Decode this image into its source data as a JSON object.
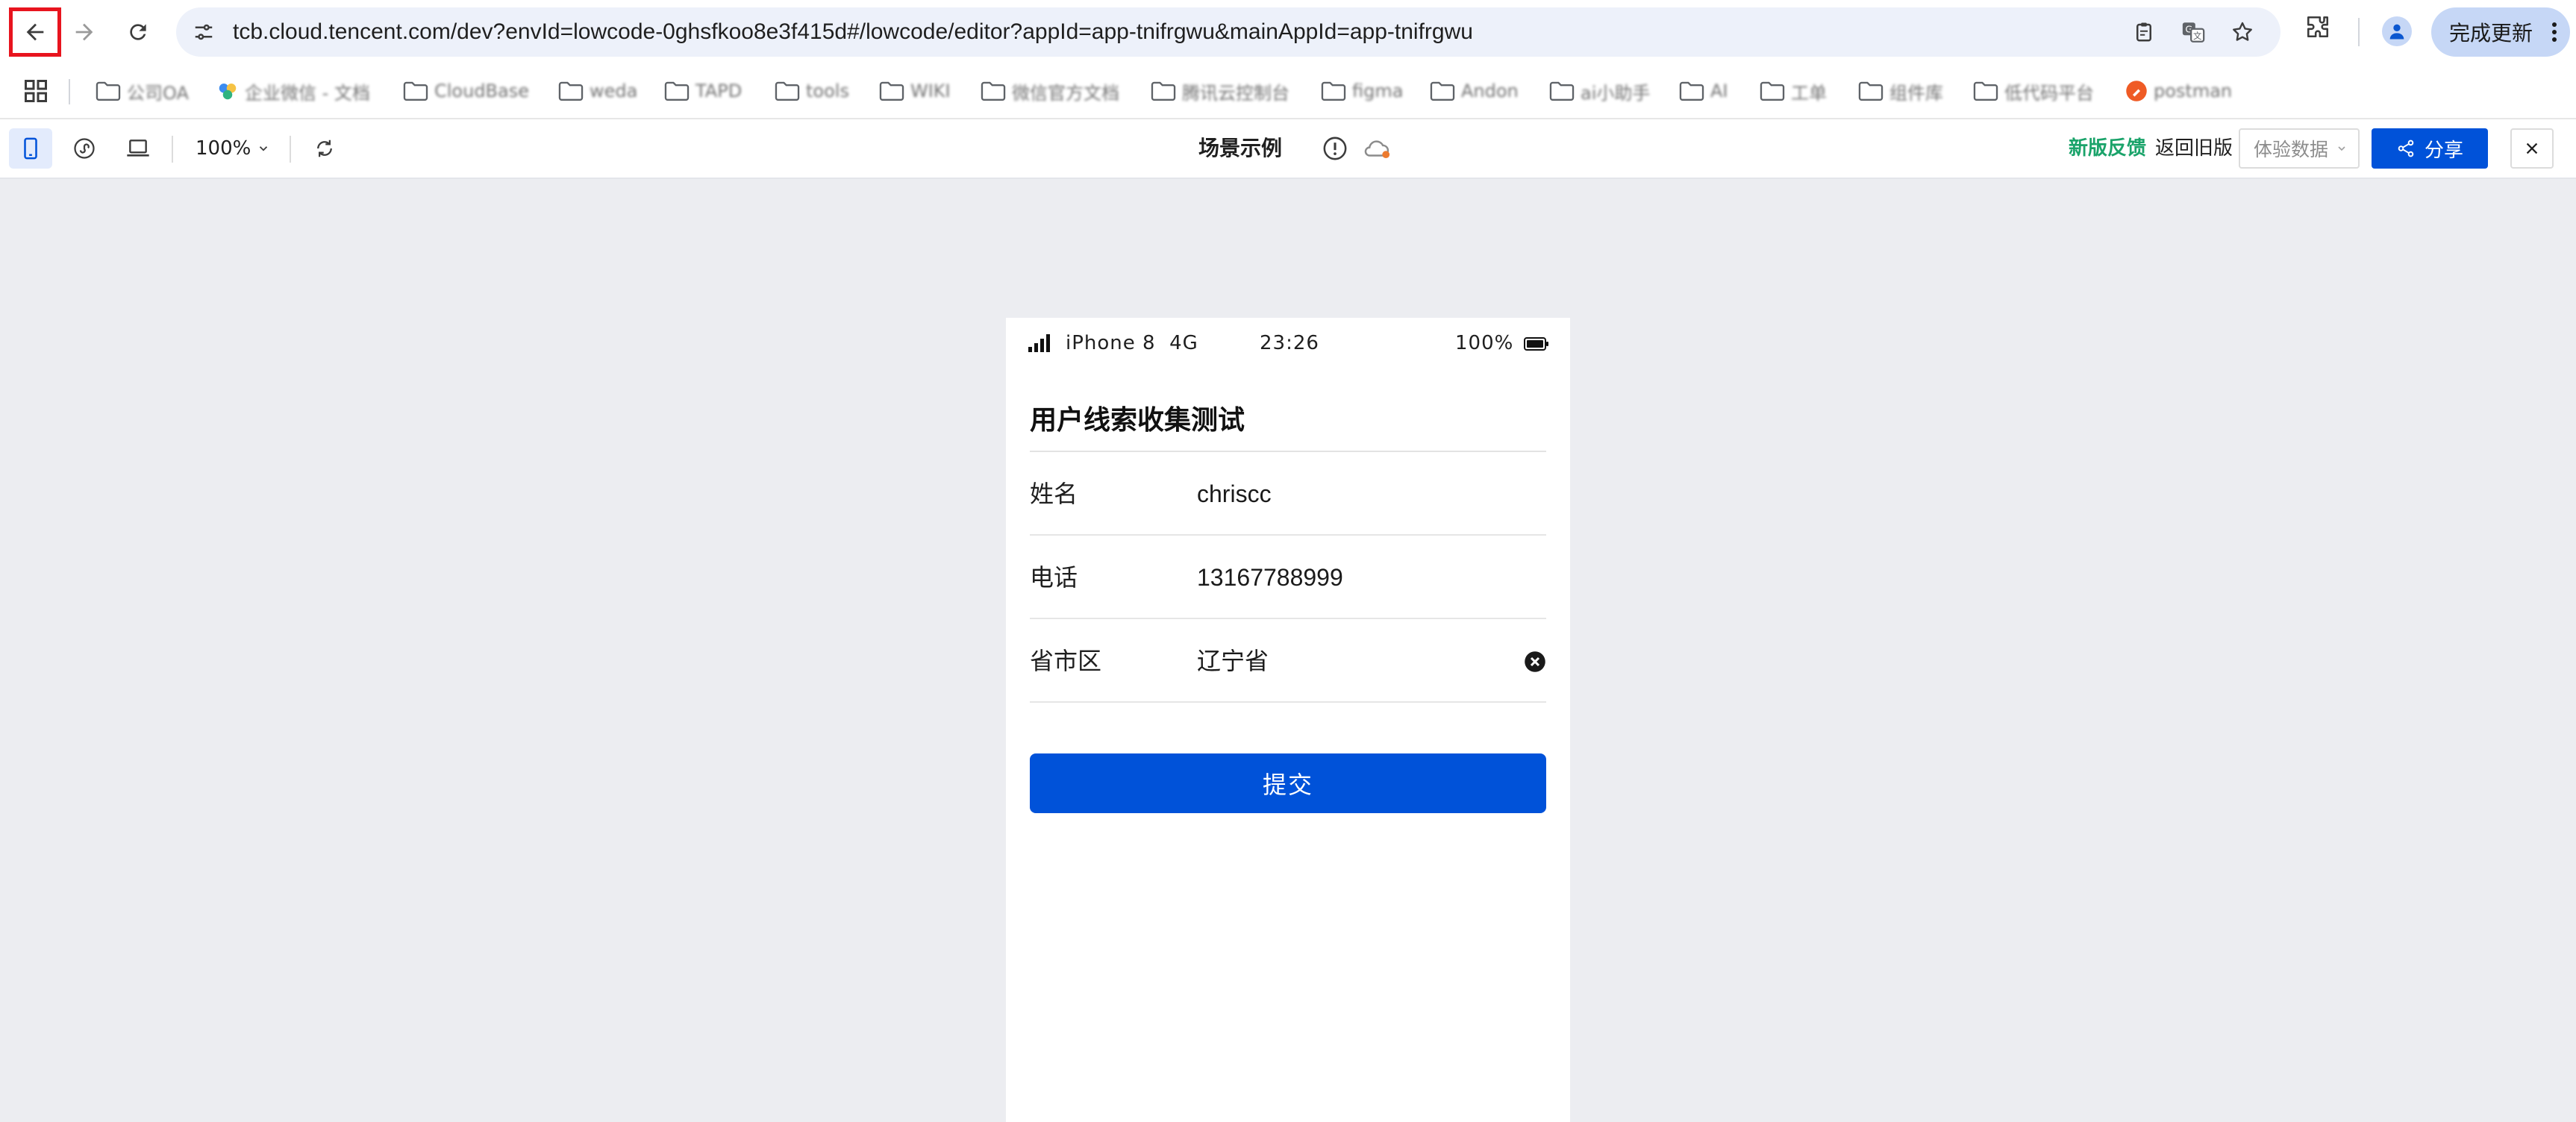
{
  "browser": {
    "url": "tcb.cloud.tencent.com/dev?envId=lowcode-0ghsfkoo8e3f415d#/lowcode/editor?appId=app-tnifrgwu&mainAppId=app-tnifrgwu",
    "update_button": "完成更新",
    "icons": [
      "back-arrow-icon",
      "forward-arrow-icon",
      "reload-icon",
      "site-settings-icon",
      "clipboard-icon",
      "translate-icon",
      "star-icon",
      "extensions-icon",
      "profile-icon",
      "more-vert-icon"
    ]
  },
  "bookmarks": [
    {
      "label": "公司OA",
      "icon": "folder-icon"
    },
    {
      "label": "企业微信 - 文档",
      "icon": "wecom-icon"
    },
    {
      "label": "CloudBase",
      "icon": "folder-icon"
    },
    {
      "label": "weda",
      "icon": "folder-icon"
    },
    {
      "label": "TAPD",
      "icon": "folder-icon"
    },
    {
      "label": "tools",
      "icon": "folder-icon"
    },
    {
      "label": "WIKI",
      "icon": "folder-icon"
    },
    {
      "label": "微信官方文档",
      "icon": "folder-icon"
    },
    {
      "label": "腾讯云控制台",
      "icon": "folder-icon"
    },
    {
      "label": "figma",
      "icon": "folder-icon"
    },
    {
      "label": "Andon",
      "icon": "folder-icon"
    },
    {
      "label": "ai小助手",
      "icon": "folder-icon"
    },
    {
      "label": "AI",
      "icon": "folder-icon"
    },
    {
      "label": "工单",
      "icon": "folder-icon"
    },
    {
      "label": "组件库",
      "icon": "folder-icon"
    },
    {
      "label": "低代码平台",
      "icon": "folder-icon"
    },
    {
      "label": "postman",
      "icon": "postman-icon"
    }
  ],
  "editor": {
    "zoom": "100%",
    "title": "场景示例",
    "feedback": "新版反馈",
    "back_old": "返回旧版",
    "data_select": "体验数据",
    "share": "分享",
    "colors": {
      "primary": "#0052d9",
      "feedback_green": "#1aa36a",
      "active_tool_bg": "#e3ebfc"
    }
  },
  "phone": {
    "status": {
      "carrier": "iPhone 8  4G",
      "time": "23:26",
      "battery": "100%"
    },
    "form_title": "用户线索收集测试",
    "rows": [
      {
        "label": "姓名",
        "value": "chriscc"
      },
      {
        "label": "电话",
        "value": "13167788999"
      },
      {
        "label": "省市区",
        "value": "辽宁省"
      }
    ],
    "submit": "提交"
  }
}
